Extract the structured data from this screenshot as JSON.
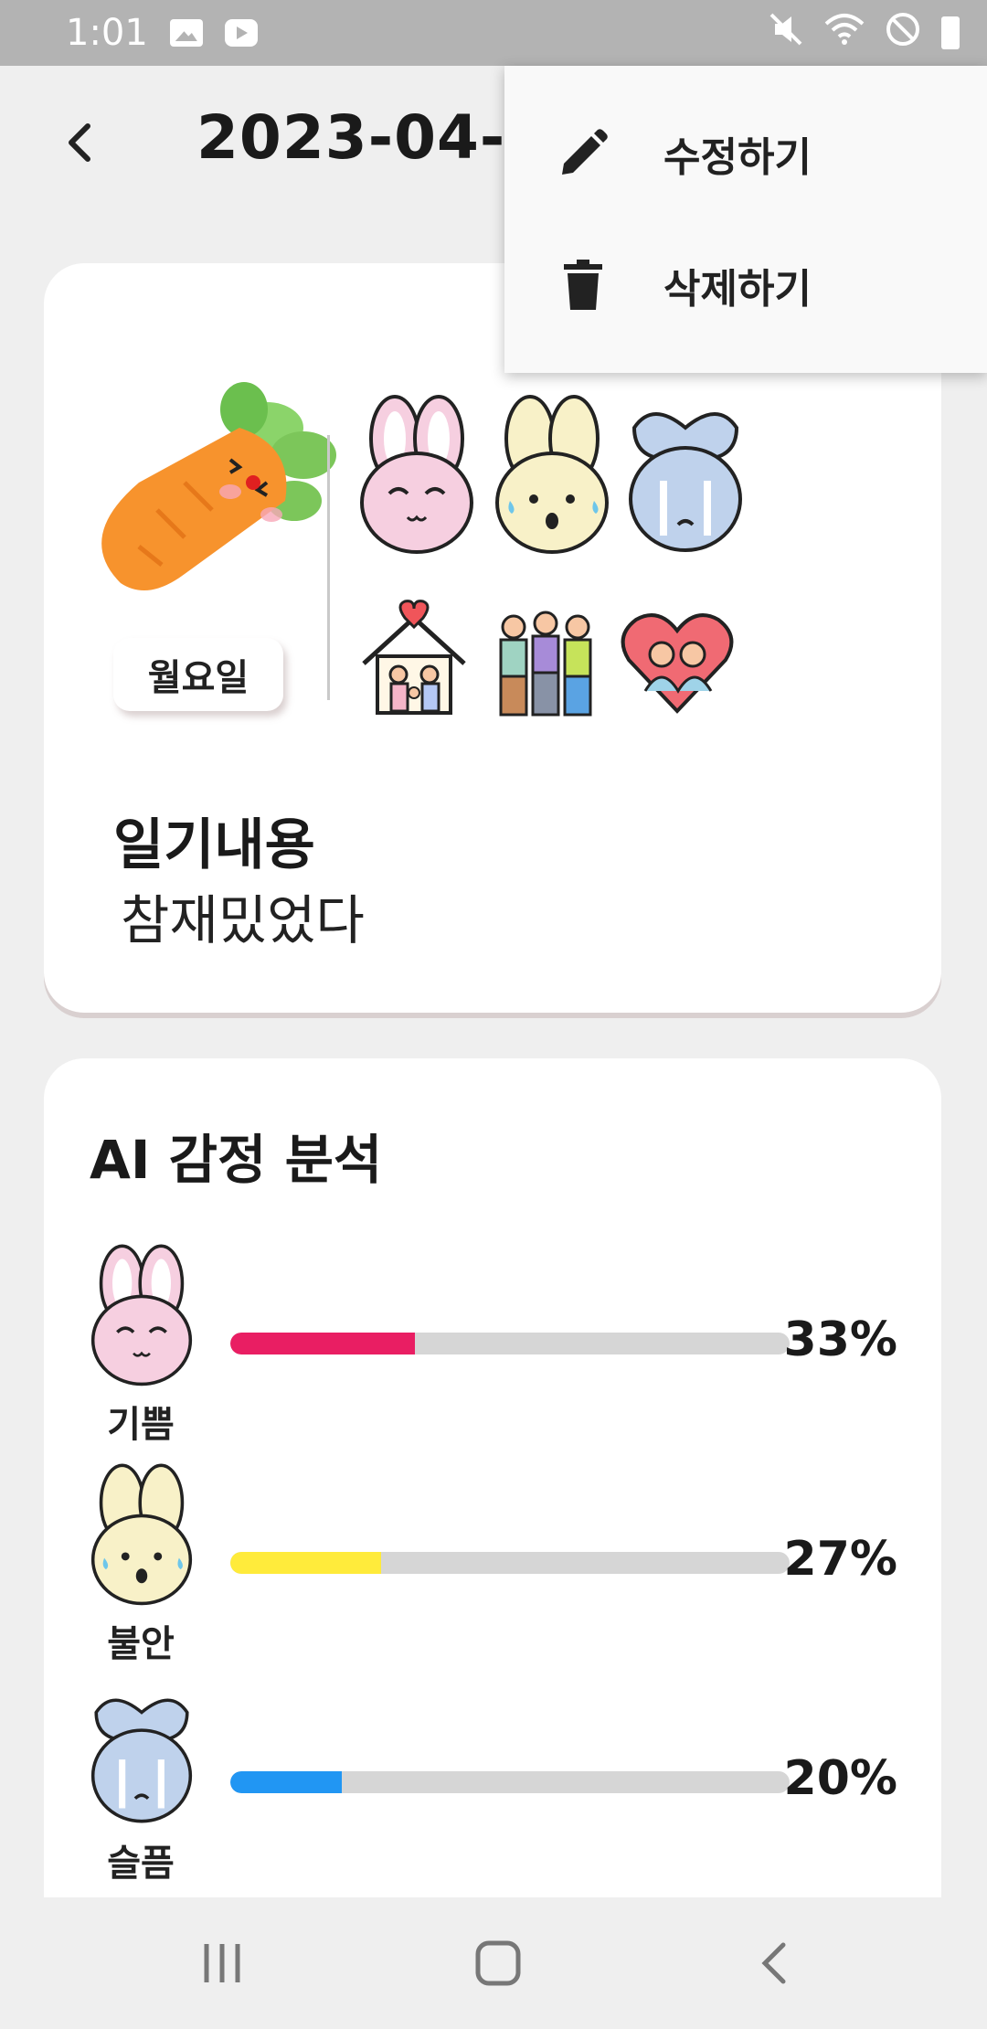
{
  "status_bar": {
    "time": "1:01",
    "icons": [
      "image-notification-icon",
      "youtube-notification-icon",
      "mute-icon",
      "wifi-icon",
      "do-not-disturb-icon",
      "battery-icon"
    ]
  },
  "header": {
    "title": "2023-04-",
    "back_icon": "chevron-left-icon"
  },
  "menu": {
    "items": [
      {
        "label": "수정하기",
        "icon": "pencil-icon"
      },
      {
        "label": "삭제하기",
        "icon": "trash-icon"
      }
    ]
  },
  "diary": {
    "weekday": "월요일",
    "weather_icon": "carrot-character-icon",
    "emotions": [
      "joy-bunny-icon",
      "anxiety-bunny-icon",
      "sadness-bunny-icon"
    ],
    "activities": [
      "family-home-icon",
      "friends-group-icon",
      "love-heart-icon"
    ],
    "heading": "일기내용",
    "content": "참재밌었다"
  },
  "analysis": {
    "title": "AI 감정 분석",
    "rows": [
      {
        "label": "기쁨",
        "percent_text": "33%",
        "value": 33,
        "color": "#e91e63"
      },
      {
        "label": "불안",
        "percent_text": "27%",
        "value": 27,
        "color": "#ffeb3b"
      },
      {
        "label": "슬픔",
        "percent_text": "20%",
        "value": 20,
        "color": "#2196f3"
      }
    ]
  },
  "colors": {
    "status_bar": "#b3b3b3",
    "background": "#efefef",
    "card": "#ffffff",
    "track": "#d6d6d6"
  }
}
